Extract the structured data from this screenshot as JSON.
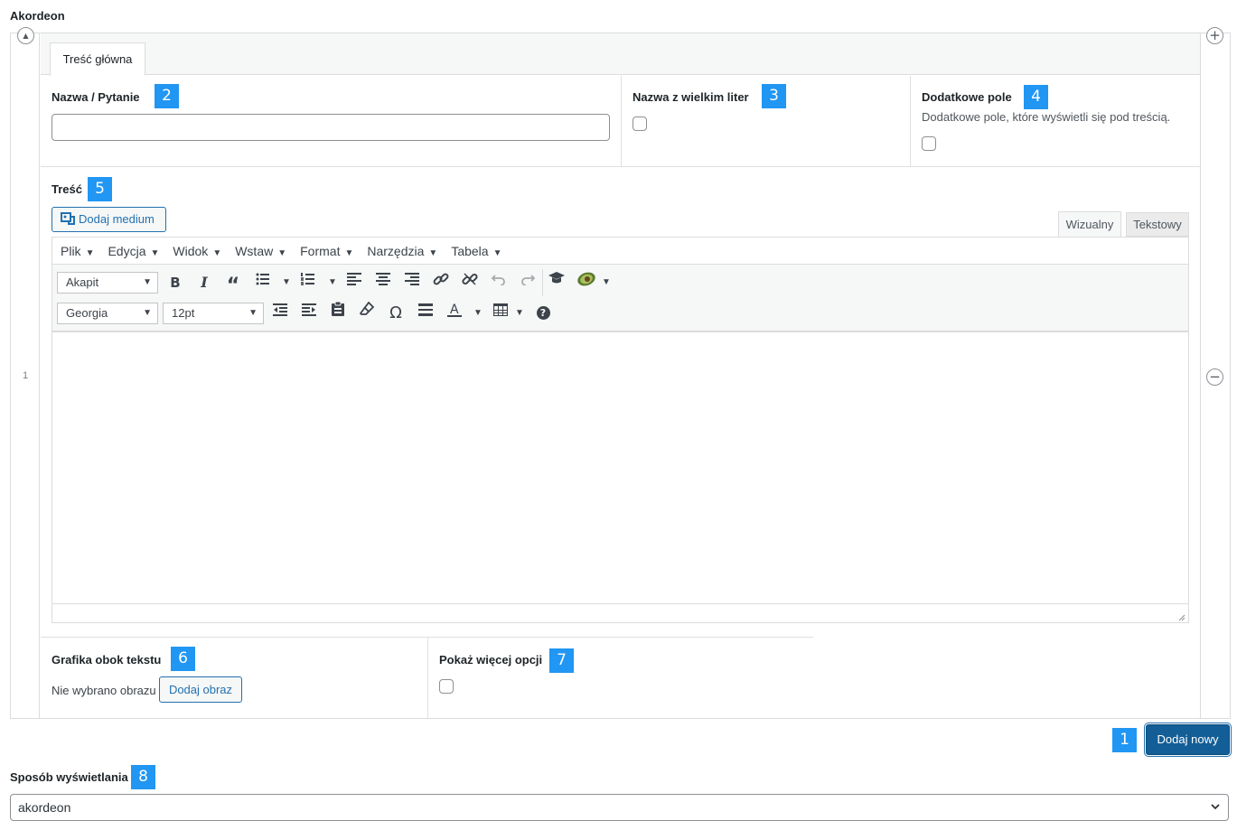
{
  "section_title": "Akordeon",
  "row_number": "1",
  "tab_label": "Treść główna",
  "fields": {
    "name": {
      "label": "Nazwa / Pytanie",
      "badge": "2",
      "value": ""
    },
    "uppercase": {
      "label": "Nazwa z wielkim liter",
      "badge": "3"
    },
    "extra": {
      "label": "Dodatkowe pole",
      "badge": "4",
      "description": "Dodatkowe pole, które wyświetli się pod treścią."
    },
    "content": {
      "label": "Treść",
      "badge": "5"
    },
    "image": {
      "label": "Grafika obok tekstu",
      "badge": "6",
      "no_image_text": "Nie wybrano obrazu",
      "button": "Dodaj obraz"
    },
    "more": {
      "label": "Pokaż więcej opcji",
      "badge": "7"
    }
  },
  "editor": {
    "add_media": "Dodaj medium",
    "tab_visual": "Wizualny",
    "tab_text": "Tekstowy",
    "menu": [
      "Plik",
      "Edycja",
      "Widok",
      "Wstaw",
      "Format",
      "Narzędzia",
      "Tabela"
    ],
    "paragraph_select": "Akapit",
    "font_select": "Georgia",
    "size_select": "12pt",
    "icons": {
      "row1": [
        "bold-icon",
        "italic-icon",
        "blockquote-icon",
        "bullet-list-icon",
        "numbered-list-icon",
        "align-left-icon",
        "align-center-icon",
        "align-right-icon",
        "link-icon",
        "unlink-icon",
        "undo-icon",
        "redo-icon",
        "graduation-cap-icon",
        "avocado-icon"
      ],
      "row2": [
        "outdent-icon",
        "indent-icon",
        "paste-icon",
        "eraser-icon",
        "omega-icon",
        "horizontal-rule-icon",
        "text-color-icon",
        "table-icon",
        "help-icon"
      ]
    }
  },
  "add_new": {
    "badge": "1",
    "label": "Dodaj nowy"
  },
  "display": {
    "label": "Sposób wyświetlania",
    "badge": "8",
    "value": "akordeon"
  },
  "colors": {
    "accent": "#2271b1",
    "badge": "#2196f3",
    "button_primary": "#135e96"
  }
}
